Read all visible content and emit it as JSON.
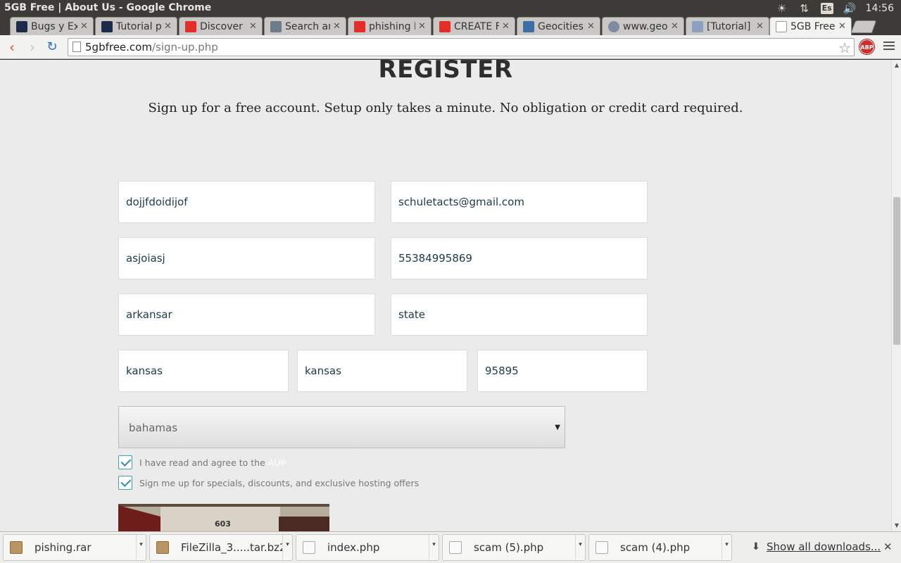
{
  "window": {
    "title": "5GB Free | About Us - Google Chrome"
  },
  "tray": {
    "lang": "Es",
    "clock": "14:56"
  },
  "tabs": [
    {
      "label": "Bugs y Ex",
      "favicon_color": "#1c2b4a"
    },
    {
      "label": "Tutorial p",
      "favicon_color": "#1c2b4a"
    },
    {
      "label": "Discover I",
      "favicon_color": "#e52d27"
    },
    {
      "label": "Search an",
      "favicon_color": "#6b7b8c"
    },
    {
      "label": "phishing I",
      "favicon_color": "#e52d27"
    },
    {
      "label": "CREATE F",
      "favicon_color": "#e52d27"
    },
    {
      "label": "Geocities",
      "favicon_color": "#3a6ea5"
    },
    {
      "label": "www.geo",
      "favicon_color": "#7d8ca0"
    },
    {
      "label": "[Tutorial]",
      "favicon_color": "#8da0c0"
    },
    {
      "label": "5GB Free",
      "favicon_color": "#ffffff"
    }
  ],
  "address": {
    "domain": "5gbfree.com",
    "path": "/sign-up.php"
  },
  "toolbar": {
    "abp_label": "ABP"
  },
  "page": {
    "heading": "REGISTER",
    "subheading": "Sign up for a free account. Setup only takes a minute. No obligation or credit card required.",
    "fields": {
      "username": "dojjfdoidijof",
      "email": "schuletacts@gmail.com",
      "name": "asjoiasj",
      "phone": "55384995869",
      "address": "arkansar",
      "state": "state",
      "city": "kansas",
      "region": "kansas",
      "zip": "95895"
    },
    "country": "bahamas",
    "checks": {
      "aup_text": "I have read and agree to the",
      "aup_link": "AUP",
      "offers_text": "Sign me up for specials, discounts, and exclusive hosting offers"
    },
    "captcha_number": "603"
  },
  "downloads": {
    "items": [
      {
        "label": "pishing.rar",
        "kind": "archive"
      },
      {
        "label": "FileZilla_3.....tar.bz2",
        "kind": "archive"
      },
      {
        "label": "index.php",
        "kind": "file"
      },
      {
        "label": "scam (5).php",
        "kind": "file"
      },
      {
        "label": "scam (4).php",
        "kind": "file"
      }
    ],
    "show_all": "Show all downloads..."
  }
}
